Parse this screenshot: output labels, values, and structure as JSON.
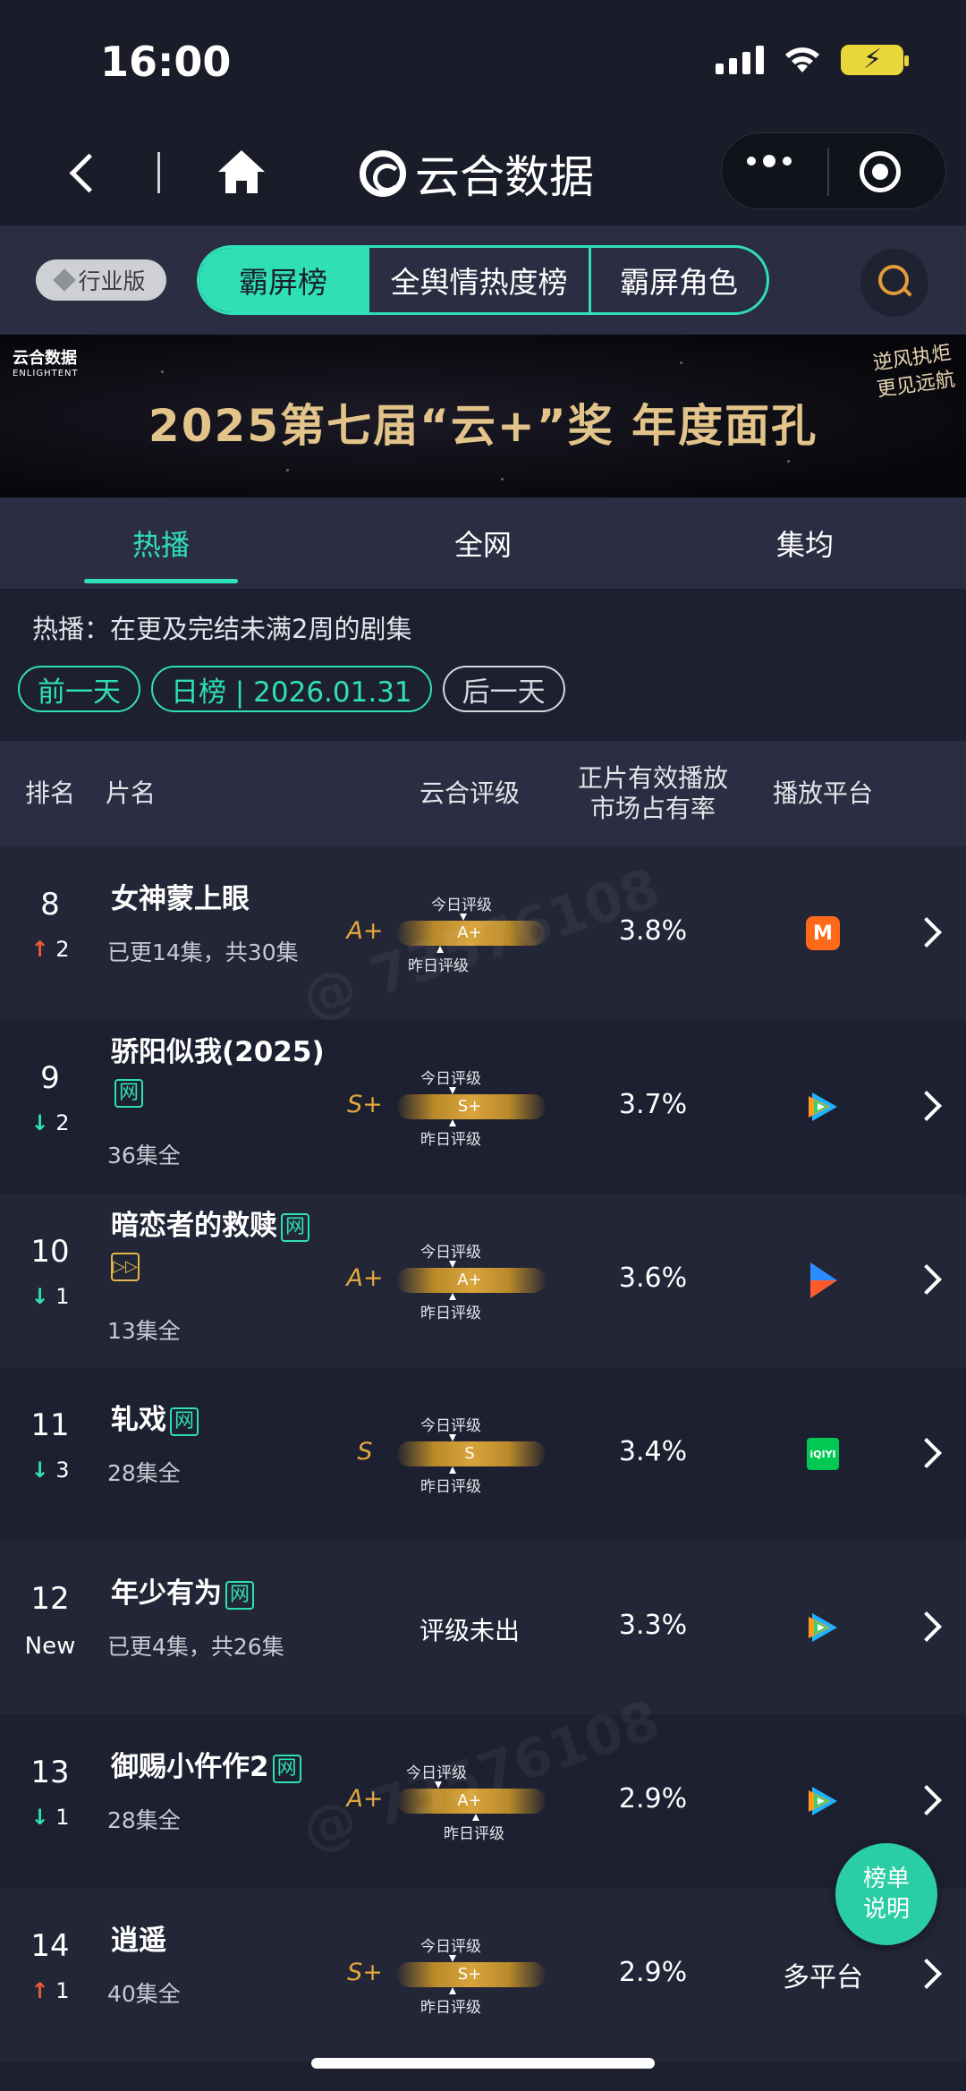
{
  "status": {
    "time": "16:00"
  },
  "nav": {
    "title": "云合数据"
  },
  "board": {
    "badge": "行业版",
    "tabs": [
      "霸屏榜",
      "全舆情热度榜",
      "霸屏角色"
    ]
  },
  "banner": {
    "logo_cn": "云合数据",
    "logo_en": "ENLIGHTENT",
    "title": "2025第七届“云+”奖  年度面孔",
    "slogan_line1": "逆风执炬",
    "slogan_line2": "更见远航"
  },
  "main_tabs": [
    "热播",
    "全网",
    "集均"
  ],
  "desc": "热播：在更及完结未满2周的剧集",
  "date": {
    "prev": "前一天",
    "current": "日榜 | 2026.01.31",
    "next": "后一天"
  },
  "columns": {
    "rank": "排名",
    "title": "片名",
    "grade": "云合评级",
    "share_l1": "正片有效播放",
    "share_l2": "市场占有率",
    "platform": "播放平台"
  },
  "grade_caption": {
    "today": "今日评级",
    "yesterday": "昨日评级"
  },
  "rows": [
    {
      "rank": "8",
      "dir": "up",
      "change": "2",
      "title": "女神蒙上眼",
      "tag": "",
      "sub": "已更14集，共30集",
      "grade": "A+",
      "bar": "A+",
      "share": "3.8%",
      "platform": "mango-tv-icon",
      "platform_text": ""
    },
    {
      "rank": "9",
      "dir": "down",
      "change": "2",
      "title": "骄阳似我(2025)",
      "tag": "网",
      "sub": "36集全",
      "grade": "S+",
      "bar": "S+",
      "share": "3.7%",
      "platform": "tencent-video-icon",
      "platform_text": ""
    },
    {
      "rank": "10",
      "dir": "down",
      "change": "1",
      "title": "暗恋者的救赎",
      "tag": "网",
      "sub": "13集全",
      "grade": "A+",
      "bar": "A+",
      "share": "3.6%",
      "platform": "youku-icon",
      "platform_text": ""
    },
    {
      "rank": "11",
      "dir": "down",
      "change": "3",
      "title": "轧戏",
      "tag": "网",
      "sub": "28集全",
      "grade": "S",
      "bar": "S",
      "share": "3.4%",
      "platform": "iqiyi-icon",
      "platform_text": "iQIYI"
    },
    {
      "rank": "12",
      "dir": "new",
      "change": "New",
      "title": "年少有为",
      "tag": "网",
      "sub": "已更4集，共26集",
      "grade": "",
      "bar": "",
      "no_grade": "评级未出",
      "share": "3.3%",
      "platform": "tencent-video-icon",
      "platform_text": ""
    },
    {
      "rank": "13",
      "dir": "down",
      "change": "1",
      "title": "御赐小仵作2",
      "tag": "网",
      "sub": "28集全",
      "grade": "A+",
      "bar": "A+",
      "share": "2.9%",
      "platform": "tencent-video-icon",
      "platform_text": ""
    },
    {
      "rank": "14",
      "dir": "up",
      "change": "1",
      "title": "逍遥",
      "tag": "",
      "sub": "40集全",
      "grade": "S+",
      "bar": "S+",
      "share": "2.9%",
      "platform": "multi-platform",
      "platform_text": "多平台"
    }
  ],
  "float_help": {
    "line1": "榜单",
    "line2": "说明"
  },
  "colors": {
    "accent": "#2fe0b5",
    "grade": "#e3a83c",
    "up": "#f05a35",
    "down": "#2fe0b5",
    "bg": "#1d2030"
  }
}
